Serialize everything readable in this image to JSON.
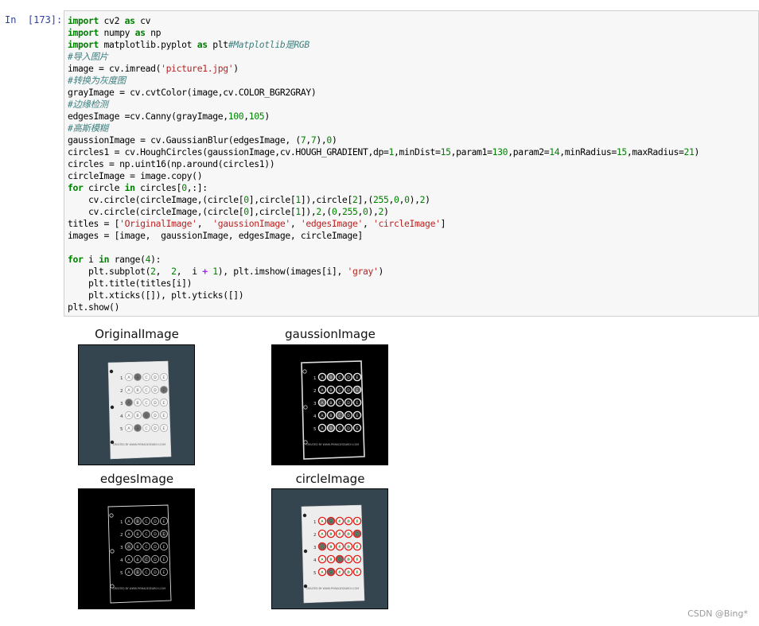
{
  "cell": {
    "prompt": "In  [173]:",
    "code_lines": [
      [
        {
          "t": "import",
          "c": "kw"
        },
        {
          "t": " cv2 "
        },
        {
          "t": "as",
          "c": "kw"
        },
        {
          "t": " cv"
        }
      ],
      [
        {
          "t": "import",
          "c": "kw"
        },
        {
          "t": " numpy "
        },
        {
          "t": "as",
          "c": "kw"
        },
        {
          "t": " np"
        }
      ],
      [
        {
          "t": "import",
          "c": "kw"
        },
        {
          "t": " matplotlib.pyplot "
        },
        {
          "t": "as",
          "c": "kw"
        },
        {
          "t": " plt"
        },
        {
          "t": "#Matplotlib是RGB",
          "c": "cm"
        }
      ],
      [
        {
          "t": "#导入图片",
          "c": "cm"
        }
      ],
      [
        {
          "t": "image = cv.imread("
        },
        {
          "t": "'picture1.jpg'",
          "c": "st"
        },
        {
          "t": ")"
        }
      ],
      [
        {
          "t": "#转换为灰度图",
          "c": "cm"
        }
      ],
      [
        {
          "t": "grayImage = cv.cvtColor(image,cv.COLOR_BGR2GRAY)"
        }
      ],
      [
        {
          "t": "#边缘检测",
          "c": "cm"
        }
      ],
      [
        {
          "t": "edgesImage =cv.Canny(grayImage,"
        },
        {
          "t": "100",
          "c": "nm"
        },
        {
          "t": ","
        },
        {
          "t": "105",
          "c": "nm"
        },
        {
          "t": ")"
        }
      ],
      [
        {
          "t": "#高斯模糊",
          "c": "cm"
        }
      ],
      [
        {
          "t": "gaussionImage = cv.GaussianBlur(edgesImage, ("
        },
        {
          "t": "7",
          "c": "nm"
        },
        {
          "t": ","
        },
        {
          "t": "7",
          "c": "nm"
        },
        {
          "t": "),"
        },
        {
          "t": "0",
          "c": "nm"
        },
        {
          "t": ")"
        }
      ],
      [
        {
          "t": "circles1 = cv.HoughCircles(gaussionImage,cv.HOUGH_GRADIENT,dp="
        },
        {
          "t": "1",
          "c": "nm"
        },
        {
          "t": ",minDist="
        },
        {
          "t": "15",
          "c": "nm"
        },
        {
          "t": ",param1="
        },
        {
          "t": "130",
          "c": "nm"
        },
        {
          "t": ",param2="
        },
        {
          "t": "14",
          "c": "nm"
        },
        {
          "t": ",minRadius="
        },
        {
          "t": "15",
          "c": "nm"
        },
        {
          "t": ",maxRadius="
        },
        {
          "t": "21",
          "c": "nm"
        },
        {
          "t": ")"
        }
      ],
      [
        {
          "t": "circles = np.uint16(np.around(circles1))"
        }
      ],
      [
        {
          "t": "circleImage = image.copy()"
        }
      ],
      [
        {
          "t": "for",
          "c": "kw"
        },
        {
          "t": " circle "
        },
        {
          "t": "in",
          "c": "kw"
        },
        {
          "t": " circles["
        },
        {
          "t": "0",
          "c": "nm"
        },
        {
          "t": ",:]:"
        }
      ],
      [
        {
          "t": "    cv.circle(circleImage,(circle["
        },
        {
          "t": "0",
          "c": "nm"
        },
        {
          "t": "],circle["
        },
        {
          "t": "1",
          "c": "nm"
        },
        {
          "t": "]),circle["
        },
        {
          "t": "2",
          "c": "nm"
        },
        {
          "t": "],("
        },
        {
          "t": "255",
          "c": "nm"
        },
        {
          "t": ","
        },
        {
          "t": "0",
          "c": "nm"
        },
        {
          "t": ","
        },
        {
          "t": "0",
          "c": "nm"
        },
        {
          "t": "),"
        },
        {
          "t": "2",
          "c": "nm"
        },
        {
          "t": ")"
        }
      ],
      [
        {
          "t": "    cv.circle(circleImage,(circle["
        },
        {
          "t": "0",
          "c": "nm"
        },
        {
          "t": "],circle["
        },
        {
          "t": "1",
          "c": "nm"
        },
        {
          "t": "]),"
        },
        {
          "t": "2",
          "c": "nm"
        },
        {
          "t": ",("
        },
        {
          "t": "0",
          "c": "nm"
        },
        {
          "t": ","
        },
        {
          "t": "255",
          "c": "nm"
        },
        {
          "t": ","
        },
        {
          "t": "0",
          "c": "nm"
        },
        {
          "t": "),"
        },
        {
          "t": "2",
          "c": "nm"
        },
        {
          "t": ")"
        }
      ],
      [
        {
          "t": "titles = ["
        },
        {
          "t": "'OriginalImage'",
          "c": "st"
        },
        {
          "t": ",  "
        },
        {
          "t": "'gaussionImage'",
          "c": "st"
        },
        {
          "t": ", "
        },
        {
          "t": "'edgesImage'",
          "c": "st"
        },
        {
          "t": ", "
        },
        {
          "t": "'circleImage'",
          "c": "st"
        },
        {
          "t": "]"
        }
      ],
      [
        {
          "t": "images = [image,  gaussionImage, edgesImage, circleImage]"
        }
      ],
      [
        {
          "t": ""
        }
      ],
      [
        {
          "t": "for",
          "c": "kw"
        },
        {
          "t": " i "
        },
        {
          "t": "in",
          "c": "kw"
        },
        {
          "t": " range("
        },
        {
          "t": "4",
          "c": "nm"
        },
        {
          "t": "):"
        }
      ],
      [
        {
          "t": "    plt.subplot("
        },
        {
          "t": "2",
          "c": "nm"
        },
        {
          "t": ",  "
        },
        {
          "t": "2",
          "c": "nm"
        },
        {
          "t": ",  i "
        },
        {
          "t": "+",
          "c": "op"
        },
        {
          "t": " "
        },
        {
          "t": "1",
          "c": "nm"
        },
        {
          "t": "), plt.imshow(images[i], "
        },
        {
          "t": "'gray'",
          "c": "st"
        },
        {
          "t": ")"
        }
      ],
      [
        {
          "t": "    plt.title(titles[i])"
        }
      ],
      [
        {
          "t": "    plt.xticks([]), plt.yticks([])"
        }
      ],
      [
        {
          "t": "plt.show()"
        }
      ]
    ]
  },
  "output": {
    "subplots": [
      {
        "title": "OriginalImage",
        "style": "original"
      },
      {
        "title": "gaussionImage",
        "style": "gaussion"
      },
      {
        "title": "edgesImage",
        "style": "edges"
      },
      {
        "title": "circleImage",
        "style": "circle"
      }
    ],
    "sheet_rows": [
      {
        "num": "1",
        "letters": [
          "A",
          "B",
          "C",
          "D",
          "E"
        ],
        "filled": 1
      },
      {
        "num": "2",
        "letters": [
          "A",
          "B",
          "C",
          "D",
          "E"
        ],
        "filled": 4
      },
      {
        "num": "3",
        "letters": [
          "A",
          "B",
          "C",
          "D",
          "E"
        ],
        "filled": 0
      },
      {
        "num": "4",
        "letters": [
          "A",
          "B",
          "C",
          "D",
          "E"
        ],
        "filled": 2
      },
      {
        "num": "5",
        "letters": [
          "A",
          "B",
          "C",
          "D",
          "E"
        ],
        "filled": 1
      }
    ],
    "sheet_footer": "CREATED BY WWW.PYIMAGESEARCH.COM"
  },
  "watermark": "CSDN @Bing*"
}
